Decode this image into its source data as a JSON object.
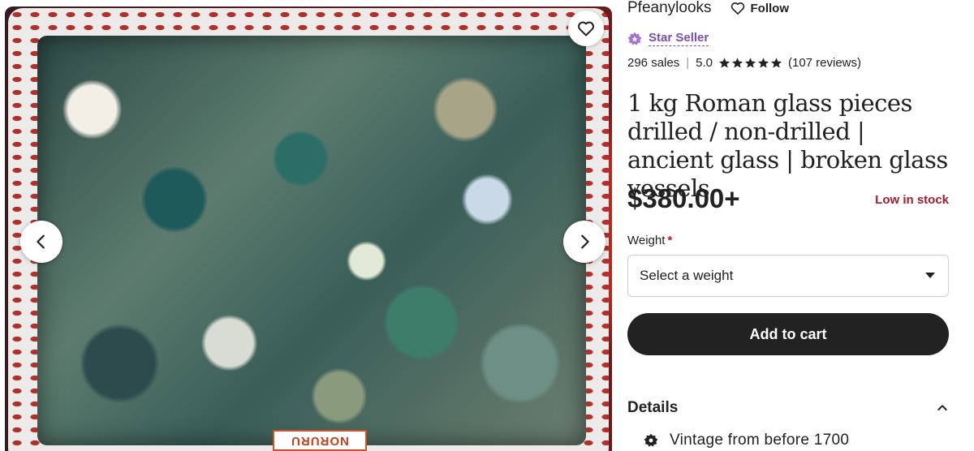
{
  "shop": {
    "name": "Pfeanylooks",
    "follow_label": "Follow",
    "badge_label": "Star Seller",
    "sales": "296 sales",
    "rating_value": "5.0",
    "rating_stars": 5,
    "reviews": "(107 reviews)"
  },
  "product": {
    "title": "1 kg Roman glass pieces drilled / non-drilled | ancient glass | broken glass vessels",
    "price": "$380.00+",
    "stock_status": "Low in stock",
    "image_label": "NORURU"
  },
  "options": {
    "weight_label": "Weight",
    "required_marker": "*",
    "weight_placeholder": "Select a weight"
  },
  "actions": {
    "add_to_cart": "Add to cart"
  },
  "details": {
    "heading": "Details",
    "item": "Vintage from before 1700"
  },
  "colors": {
    "star_seller": "#7b4fb0",
    "stock_warning": "#a61a2e",
    "cart_button": "#222222"
  }
}
